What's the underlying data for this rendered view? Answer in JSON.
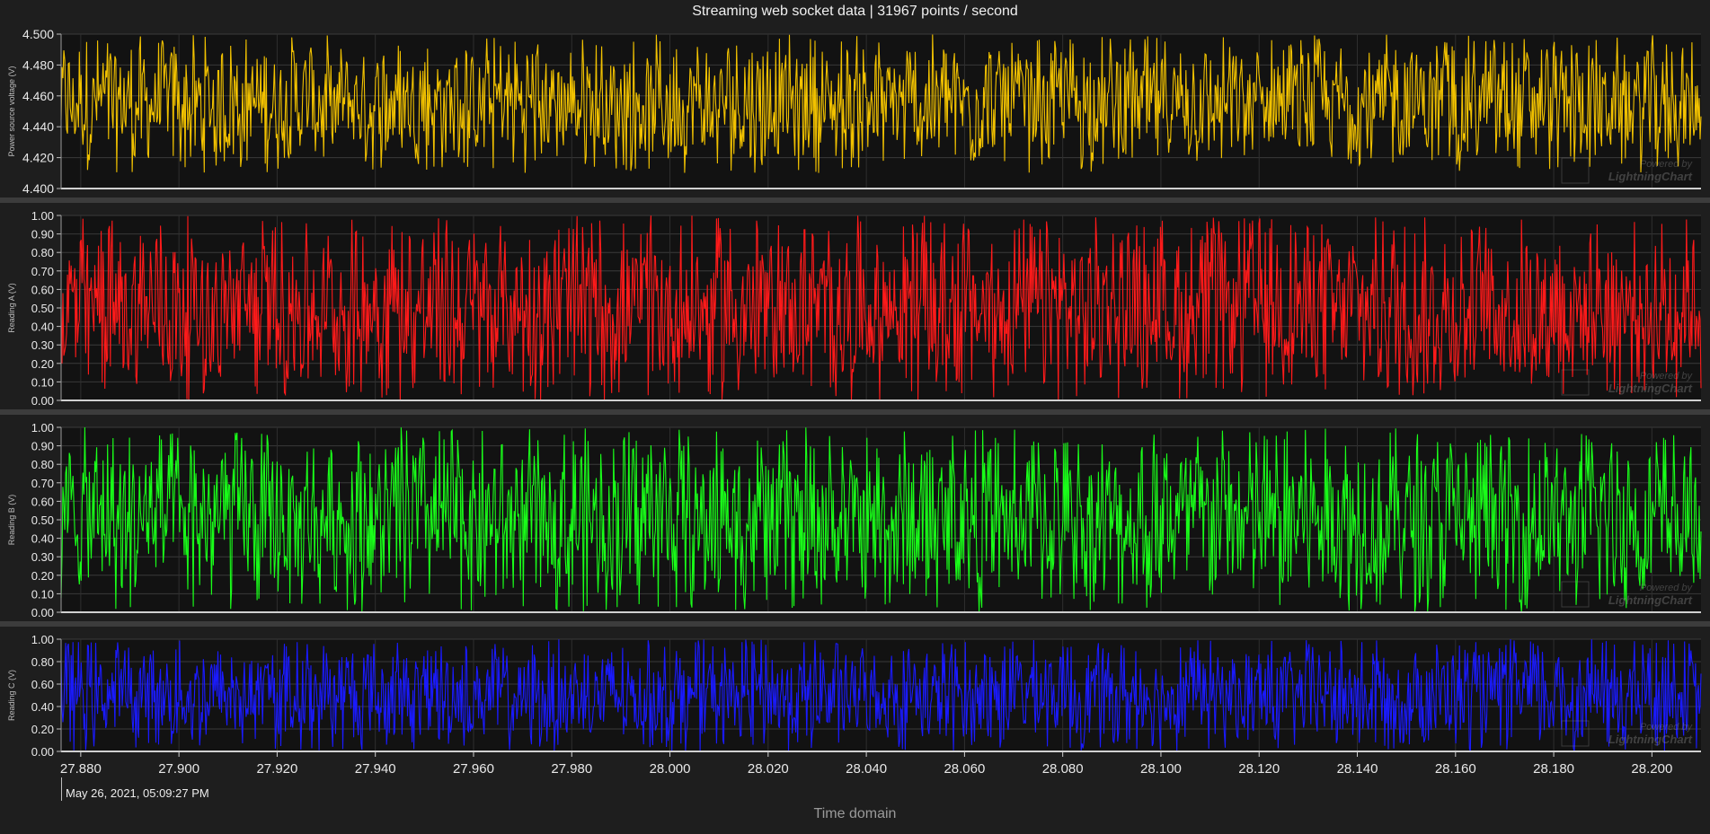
{
  "title": "Streaming web socket data | 31967 points / second",
  "watermark": {
    "powered_by": "Powered by",
    "brand": "LightningChart"
  },
  "chart_data": {
    "type": "line",
    "title": "Streaming web socket data | 31967 points / second",
    "xlabel": "Time domain",
    "x_origin_label": "May 26, 2021, 05:09:27 PM",
    "xlim": [
      27.876,
      28.21
    ],
    "x_ticks": [
      "27.880",
      "27.900",
      "27.920",
      "27.940",
      "27.960",
      "27.980",
      "28.000",
      "28.020",
      "28.040",
      "28.060",
      "28.080",
      "28.100",
      "28.120",
      "28.140",
      "28.160",
      "28.180",
      "28.200"
    ],
    "grid": true,
    "series": [
      {
        "ylabel": "Power source voltage (V)",
        "color": "#f2c200",
        "ylim": [
          4.4,
          4.5
        ],
        "y_ticks": [
          "4.500",
          "4.480",
          "4.460",
          "4.440",
          "4.420",
          "4.400"
        ],
        "value_range": [
          4.41,
          4.5
        ],
        "mean": 4.455
      },
      {
        "ylabel": "Reading A (V)",
        "color": "#ff1a1a",
        "ylim": [
          0,
          1
        ],
        "y_ticks": [
          "1.00",
          "0.90",
          "0.80",
          "0.70",
          "0.60",
          "0.50",
          "0.40",
          "0.30",
          "0.20",
          "0.10",
          "0.00"
        ],
        "value_range": [
          0,
          1
        ],
        "mean": 0.5
      },
      {
        "ylabel": "Reading B (V)",
        "color": "#19ff19",
        "ylim": [
          0,
          1
        ],
        "y_ticks": [
          "1.00",
          "0.90",
          "0.80",
          "0.70",
          "0.60",
          "0.50",
          "0.40",
          "0.30",
          "0.20",
          "0.10",
          "0.00"
        ],
        "value_range": [
          0,
          1
        ],
        "mean": 0.5
      },
      {
        "ylabel": "Reading C (V)",
        "color": "#1a1aff",
        "ylim": [
          0,
          1
        ],
        "y_ticks": [
          "1.00",
          "0.80",
          "0.60",
          "0.40",
          "0.20",
          "0.00"
        ],
        "value_range": [
          0,
          1
        ],
        "mean": 0.5
      }
    ]
  }
}
